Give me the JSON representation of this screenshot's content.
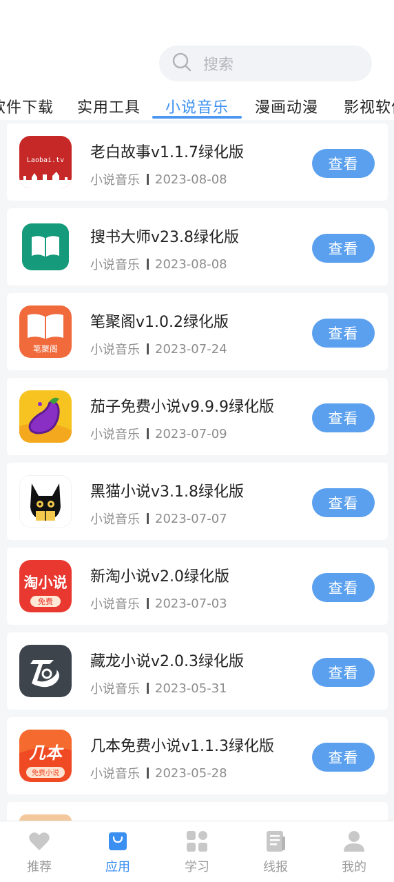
{
  "search": {
    "placeholder": "搜索"
  },
  "tabs": [
    {
      "label": "软件下载",
      "active": false
    },
    {
      "label": "实用工具",
      "active": false
    },
    {
      "label": "小说音乐",
      "active": true
    },
    {
      "label": "漫画动漫",
      "active": false
    },
    {
      "label": "影视软件",
      "active": false
    }
  ],
  "apps": [
    {
      "title": "老白故事v1.1.7绿化版",
      "category": "小说音乐",
      "date": "2023-08-08",
      "button": "查看",
      "icon_text": "Laobai.tv"
    },
    {
      "title": "搜书大师v23.8绿化版",
      "category": "小说音乐",
      "date": "2023-08-08",
      "button": "查看"
    },
    {
      "title": "笔聚阁v1.0.2绿化版",
      "category": "小说音乐",
      "date": "2023-07-24",
      "button": "查看",
      "icon_text": "笔聚阁"
    },
    {
      "title": "茄子免费小说v9.9.9绿化版",
      "category": "小说音乐",
      "date": "2023-07-09",
      "button": "查看"
    },
    {
      "title": "黑猫小说v3.1.8绿化版",
      "category": "小说音乐",
      "date": "2023-07-07",
      "button": "查看"
    },
    {
      "title": "新淘小说v2.0绿化版",
      "category": "小说音乐",
      "date": "2023-07-03",
      "button": "查看",
      "icon_text": "淘小说",
      "icon_subtext": "免费"
    },
    {
      "title": "藏龙小说v2.0.3绿化版",
      "category": "小说音乐",
      "date": "2023-05-31",
      "button": "查看"
    },
    {
      "title": "几本免费小说v1.1.3绿化版",
      "category": "小说音乐",
      "date": "2023-05-28",
      "button": "查看",
      "icon_text": "几本",
      "icon_subtext": "免费小说"
    }
  ],
  "bottom_nav": [
    {
      "label": "推荐",
      "icon": "heart-icon",
      "active": false
    },
    {
      "label": "应用",
      "icon": "shopping-bag-icon",
      "active": true
    },
    {
      "label": "学习",
      "icon": "grid-icon",
      "active": false
    },
    {
      "label": "线报",
      "icon": "document-icon",
      "active": false
    },
    {
      "label": "我的",
      "icon": "user-icon",
      "active": false
    }
  ],
  "colors": {
    "accent": "#3b8ff0",
    "button": "#5aa0ee",
    "inactive_nav": "#c8c8c8"
  }
}
